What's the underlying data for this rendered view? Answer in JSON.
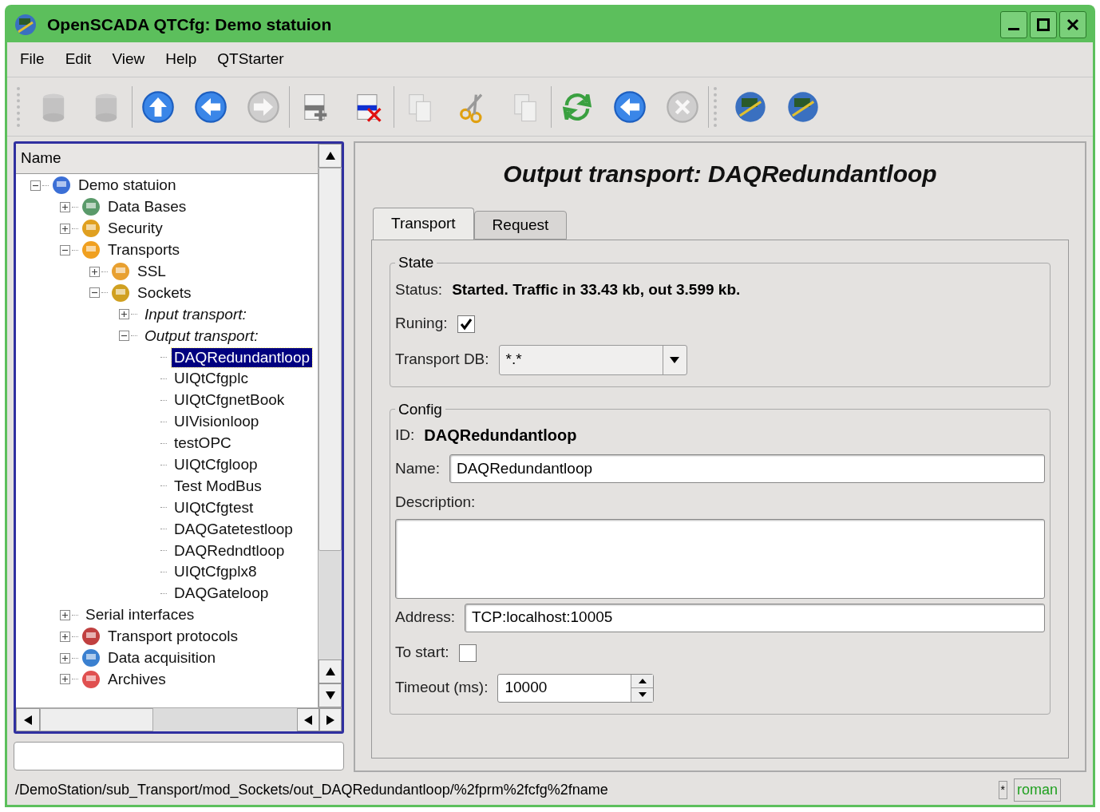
{
  "window": {
    "title": "OpenSCADA QTCfg: Demo statuion"
  },
  "menu": [
    "File",
    "Edit",
    "View",
    "Help",
    "QTStarter"
  ],
  "toolbar": [
    [
      {
        "disabled": true
      },
      {
        "disabled": true
      }
    ],
    [
      {
        "disabled": false
      },
      {
        "disabled": false
      },
      {
        "disabled": true
      }
    ],
    [
      {
        "disabled": false
      },
      {
        "disabled": false
      }
    ],
    [
      {
        "disabled": true
      },
      {
        "disabled": false
      },
      {
        "disabled": true
      }
    ],
    [
      {
        "disabled": false
      },
      {
        "disabled": false
      },
      {
        "disabled": true
      }
    ],
    [
      {
        "disabled": false
      },
      {
        "disabled": false
      }
    ]
  ],
  "tree": {
    "header": "Name",
    "items": [
      {
        "label": "Demo statuion",
        "kind": "icon",
        "expanded": true,
        "selected": false,
        "children": [
          {
            "label": "Data Bases",
            "kind": "icon",
            "expanded": false,
            "selected": false
          },
          {
            "label": "Security",
            "kind": "icon",
            "expanded": false,
            "selected": false
          },
          {
            "label": "Transports",
            "kind": "icon",
            "expanded": true,
            "selected": false,
            "children": [
              {
                "label": "SSL",
                "kind": "icon",
                "expanded": false,
                "selected": false
              },
              {
                "label": "Sockets",
                "kind": "icon",
                "expanded": true,
                "selected": false,
                "children": [
                  {
                    "label": "Input transport:",
                    "kind": "group",
                    "expanded": false,
                    "selected": false
                  },
                  {
                    "label": "Output transport:",
                    "kind": "group",
                    "expanded": true,
                    "selected": false,
                    "children": [
                      {
                        "label": "DAQRedundantloop",
                        "kind": "leaf",
                        "selected": true
                      },
                      {
                        "label": "UIQtCfgplc",
                        "kind": "leaf",
                        "selected": false
                      },
                      {
                        "label": "UIQtCfgnetBook",
                        "kind": "leaf",
                        "selected": false
                      },
                      {
                        "label": "UIVisionloop",
                        "kind": "leaf",
                        "selected": false
                      },
                      {
                        "label": "testOPC",
                        "kind": "leaf",
                        "selected": false
                      },
                      {
                        "label": "UIQtCfgloop",
                        "kind": "leaf",
                        "selected": false
                      },
                      {
                        "label": "Test ModBus",
                        "kind": "leaf",
                        "selected": false
                      },
                      {
                        "label": "UIQtCfgtest",
                        "kind": "leaf",
                        "selected": false
                      },
                      {
                        "label": "DAQGatetestloop",
                        "kind": "leaf",
                        "selected": false
                      },
                      {
                        "label": "DAQRedndtloop",
                        "kind": "leaf",
                        "selected": false
                      },
                      {
                        "label": "UIQtCfgplx8",
                        "kind": "leaf",
                        "selected": false
                      },
                      {
                        "label": "DAQGateloop",
                        "kind": "leaf",
                        "selected": false
                      }
                    ]
                  }
                ]
              }
            ]
          },
          {
            "label": "Serial interfaces",
            "kind": "plain",
            "expanded": false,
            "selected": false
          },
          {
            "label": "Transport protocols",
            "kind": "icon",
            "expanded": false,
            "selected": false
          },
          {
            "label": "Data acquisition",
            "kind": "icon",
            "expanded": false,
            "selected": false
          },
          {
            "label": "Archives",
            "kind": "icon",
            "expanded": false,
            "selected": false
          }
        ]
      }
    ]
  },
  "page": {
    "title": "Output transport: DAQRedundantloop",
    "tabs": [
      {
        "label": "Transport",
        "selected": true
      },
      {
        "label": "Request",
        "selected": false
      }
    ],
    "state": {
      "legend": "State",
      "status_label": "Status:",
      "status": "Started. Traffic in 33.43 kb, out 3.599 kb.",
      "running_label": "Runing:",
      "running": true,
      "db_label": "Transport DB:",
      "db": "*.*"
    },
    "config": {
      "legend": "Config",
      "id_label": "ID:",
      "id": "DAQRedundantloop",
      "name_label": "Name:",
      "name": "DAQRedundantloop",
      "description_label": "Description:",
      "address_label": "Address:",
      "address": "TCP:localhost:10005",
      "start_label": "To start:",
      "start": false,
      "timeout_label": "Timeout (ms):",
      "timeout": "10000"
    }
  },
  "status_bar": {
    "path": "/DemoStation/sub_Transport/mod_Sockets/out_DAQRedundantloop/%2fprm%2fcfg%2fname",
    "modified": "*",
    "user": "roman"
  }
}
